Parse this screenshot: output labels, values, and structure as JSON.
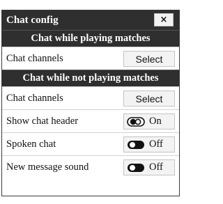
{
  "dialog": {
    "title": "Chat config",
    "close_label": "×"
  },
  "sections": [
    {
      "header": "Chat while playing matches",
      "rows": [
        {
          "label": "Chat channels",
          "button": "Select"
        }
      ]
    },
    {
      "header": "Chat while not playing matches",
      "rows": [
        {
          "label": "Chat channels",
          "button": "Select"
        },
        {
          "label": "Show chat header",
          "toggle": "On"
        },
        {
          "label": "Spoken chat",
          "toggle": "Off"
        },
        {
          "label": "New message sound",
          "toggle": "Off"
        }
      ]
    }
  ],
  "colors": {
    "header_bg": "#2f2f2f",
    "button_bg": "#f3f3f3"
  },
  "icons": {
    "toggle_on": "switch-on-icon",
    "toggle_off": "switch-off-icon",
    "close": "close-icon"
  }
}
